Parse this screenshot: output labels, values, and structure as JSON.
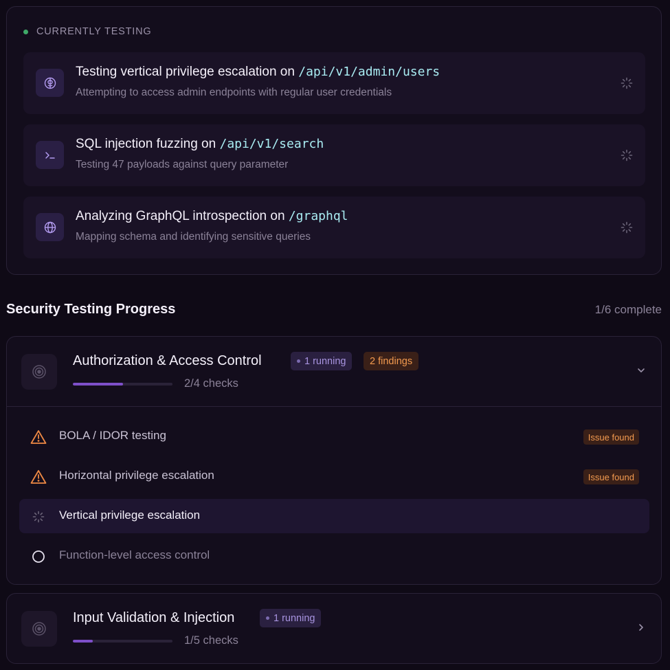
{
  "currently_testing": {
    "header": "CURRENTLY TESTING",
    "items": [
      {
        "title": "Testing vertical privilege escalation on ",
        "endpoint": "/api/v1/admin/users",
        "subtitle": "Attempting to access admin endpoints with regular user credentials",
        "icon": "brain-icon"
      },
      {
        "title": "SQL injection fuzzing on ",
        "endpoint": "/api/v1/search",
        "subtitle": "Testing 47 payloads against query parameter",
        "icon": "terminal-icon"
      },
      {
        "title": "Analyzing GraphQL introspection on ",
        "endpoint": "/graphql",
        "subtitle": "Mapping schema and identifying sensitive queries",
        "icon": "globe-icon"
      }
    ]
  },
  "progress": {
    "title": "Security Testing Progress",
    "count": "1/6 complete"
  },
  "categories": [
    {
      "name": "Authorization & Access Control",
      "running_badge": "1 running",
      "findings_badge": "2 findings",
      "progress_fraction": 0.5,
      "checks_label": "2/4 checks",
      "expanded": true,
      "checks": [
        {
          "label": "BOLA / IDOR testing",
          "status": "issue",
          "badge": "Issue found"
        },
        {
          "label": "Horizontal privilege escalation",
          "status": "issue",
          "badge": "Issue found"
        },
        {
          "label": "Vertical privilege escalation",
          "status": "running"
        },
        {
          "label": "Function-level access control",
          "status": "pending"
        }
      ]
    },
    {
      "name": "Input Validation & Injection",
      "running_badge": "1 running",
      "progress_fraction": 0.2,
      "checks_label": "1/5 checks",
      "expanded": false
    }
  ],
  "colors": {
    "accent_purple": "#7e4fc9",
    "endpoint_cyan": "#a9ecf2",
    "warning_orange": "#f39a4f",
    "live_green": "#3fa968"
  }
}
